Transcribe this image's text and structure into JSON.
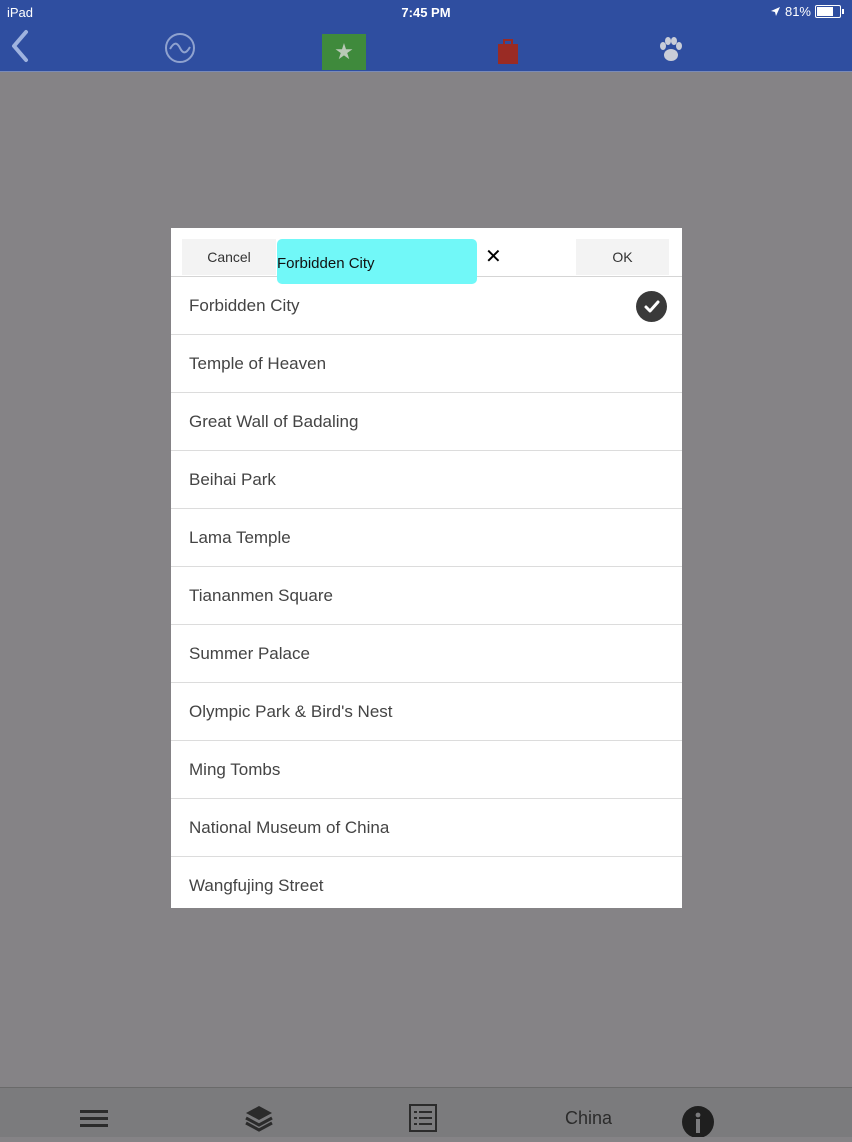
{
  "status_bar": {
    "device": "iPad",
    "time": "7:45 PM",
    "battery": "81%",
    "battery_level": 0.81
  },
  "nav": {
    "icons": [
      "back-icon",
      "wave-icon",
      "star-icon",
      "bag-icon",
      "paw-icon"
    ],
    "colors": {
      "bar": "#2f4ea0",
      "star_bg": "#3f8a3c",
      "bag": "#9a2b24"
    }
  },
  "modal": {
    "cancel_label": "Cancel",
    "search_value": "Forbidden City",
    "ok_label": "OK",
    "items": [
      {
        "label": "Forbidden City",
        "selected": true
      },
      {
        "label": "Temple of Heaven"
      },
      {
        "label": "Great Wall of Badaling"
      },
      {
        "label": "Beihai Park"
      },
      {
        "label": "Lama Temple"
      },
      {
        "label": "Tiananmen Square"
      },
      {
        "label": "Summer Palace"
      },
      {
        "label": "Olympic Park & Bird's Nest"
      },
      {
        "label": "Ming Tombs"
      },
      {
        "label": "National Museum of China"
      },
      {
        "label": "Wangfujing Street"
      }
    ]
  },
  "bottom_bar": {
    "icons": [
      "menu-icon",
      "layers-icon",
      "list-icon",
      "info-icon"
    ],
    "region_label": "China"
  }
}
